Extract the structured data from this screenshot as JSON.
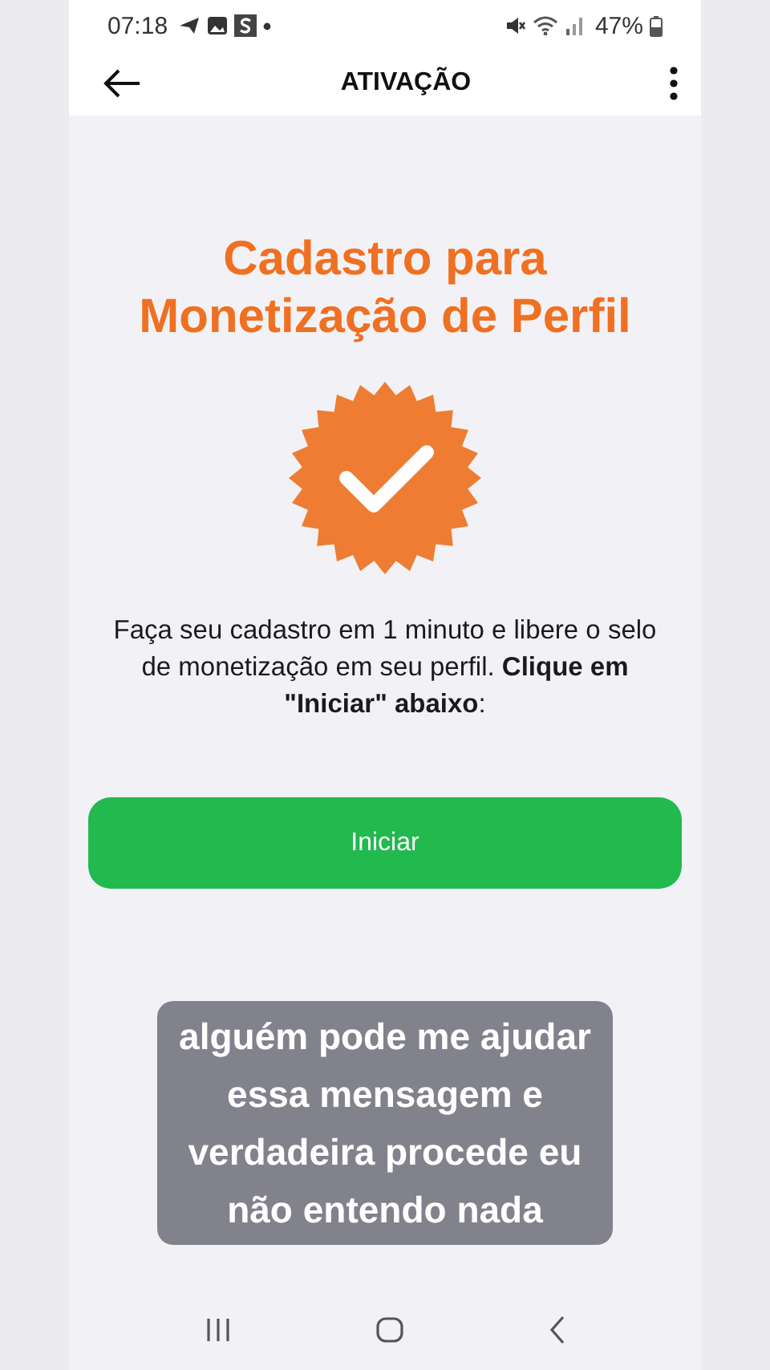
{
  "status_bar": {
    "time": "07:18",
    "battery": "47%"
  },
  "header": {
    "title": "ATIVAÇÃO"
  },
  "heading": "Cadastro para Monetização de Perfil",
  "description": "Faça seu cadastro em 1 minuto e libere o selo de monetização em seu perfil. **Clique em \"Iniciar\" abaixo**:",
  "button": "Iniciar",
  "caption": "alguém pode me ajudar essa mensagem e verdadeira procede eu não entendo nada"
}
